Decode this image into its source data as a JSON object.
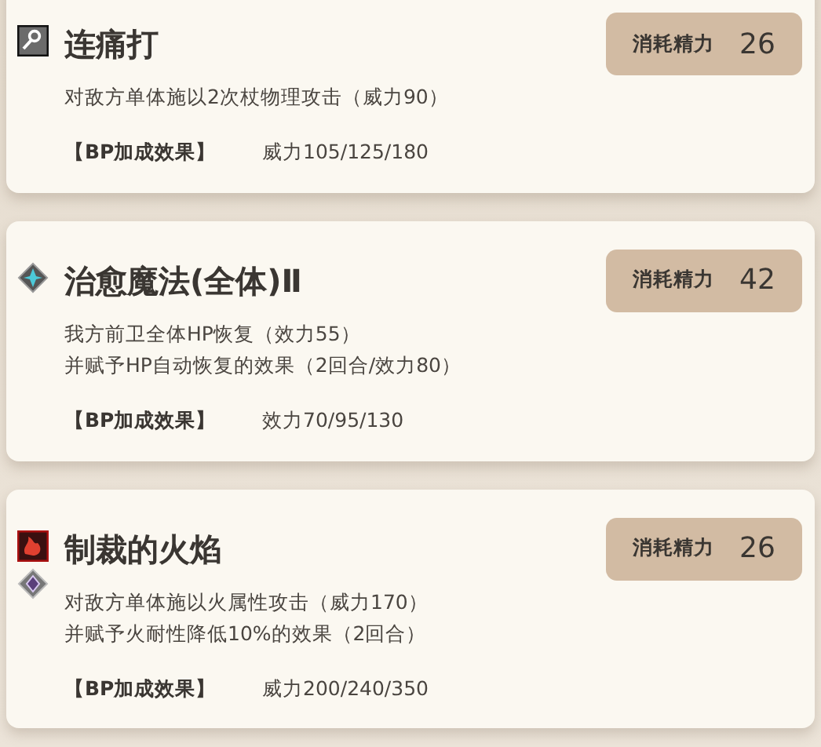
{
  "skills": [
    {
      "name": "连痛打",
      "cost_label": "消耗精力",
      "cost": "26",
      "description": [
        "对敌方单体施以2次杖物理攻击（威力90）"
      ],
      "bp_label": "【BP加成效果】",
      "bp_value": "威力105/125/180"
    },
    {
      "name": "治愈魔法(全体)Ⅱ",
      "cost_label": "消耗精力",
      "cost": "42",
      "description": [
        "我方前卫全体HP恢复（效力55）",
        "并赋予HP自动恢复的效果（2回合/效力80）"
      ],
      "bp_label": "【BP加成效果】",
      "bp_value": "效力70/95/130"
    },
    {
      "name": "制裁的火焰",
      "cost_label": "消耗精力",
      "cost": "26",
      "description": [
        "对敌方单体施以火属性攻击（威力170）",
        "并赋予火耐性降低10%的效果（2回合）"
      ],
      "bp_label": "【BP加成效果】",
      "bp_value": "威力200/240/350"
    }
  ]
}
